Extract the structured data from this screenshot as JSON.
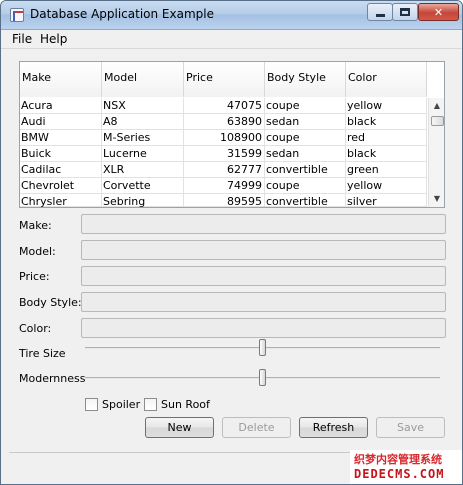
{
  "window": {
    "title": "Database Application Example"
  },
  "menu": [
    "File",
    "Help"
  ],
  "table": {
    "columns": [
      "Make",
      "Model",
      "Price",
      "Body Style",
      "Color"
    ],
    "rows": [
      [
        "Acura",
        "NSX",
        "47075",
        "coupe",
        "yellow"
      ],
      [
        "Audi",
        "A8",
        "63890",
        "sedan",
        "black"
      ],
      [
        "BMW",
        "M-Series",
        "108900",
        "coupe",
        "red"
      ],
      [
        "Buick",
        "Lucerne",
        "31599",
        "sedan",
        "black"
      ],
      [
        "Cadilac",
        "XLR",
        "62777",
        "convertible",
        "green"
      ],
      [
        "Chevrolet",
        "Corvette",
        "74999",
        "coupe",
        "yellow"
      ],
      [
        "Chrysler",
        "Sebring",
        "89595",
        "convertible",
        "silver"
      ]
    ]
  },
  "form": {
    "make_label": "Make:",
    "model_label": "Model:",
    "price_label": "Price:",
    "body_label": "Body Style:",
    "color_label": "Color:",
    "make_value": "",
    "model_value": "",
    "price_value": "",
    "body_value": "",
    "color_value": ""
  },
  "sliders": {
    "tire_label": "Tire Size",
    "tire_value_fraction": 0.5,
    "modern_label": "Modernness",
    "modern_value_fraction": 0.5
  },
  "checkboxes": {
    "spoiler_label": "Spoiler",
    "spoiler_checked": false,
    "sunroof_label": "Sun Roof",
    "sunroof_checked": false
  },
  "buttons": {
    "new_label": "New",
    "delete_label": "Delete",
    "refresh_label": "Refresh",
    "save_label": "Save"
  },
  "watermark": {
    "line1": "织梦内容管理系统",
    "line2": "DEDECMS.COM"
  },
  "icons": {
    "close": "close-icon",
    "minimize": "minimize-icon",
    "maximize": "maximize-icon",
    "scroll_up": "scroll-up-icon",
    "scroll_down": "scroll-down-icon"
  },
  "colors": {
    "title_bar": "#b5cde8",
    "close_button": "#c5473a",
    "watermark_red": "#d8282e"
  }
}
